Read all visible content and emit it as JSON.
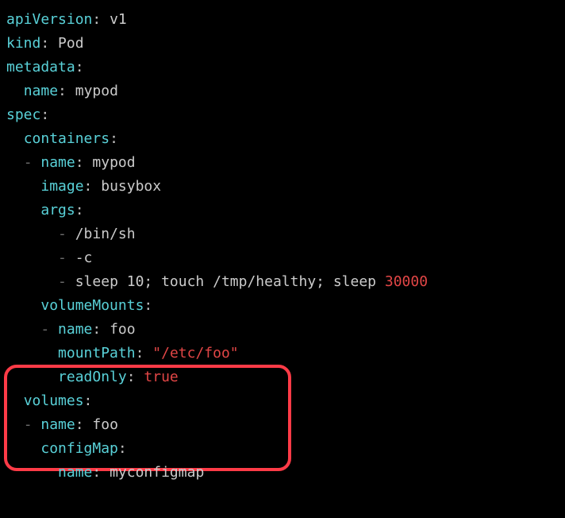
{
  "yaml": {
    "apiVersion": {
      "key": "apiVersion",
      "value": "v1"
    },
    "kind": {
      "key": "kind",
      "value": "Pod"
    },
    "metadata": {
      "key": "metadata",
      "name": {
        "key": "name",
        "value": "mypod"
      }
    },
    "spec": {
      "key": "spec",
      "containers": {
        "key": "containers",
        "item": {
          "name": {
            "key": "name",
            "value": "mypod"
          },
          "image": {
            "key": "image",
            "value": "busybox"
          },
          "args": {
            "key": "args",
            "values": [
              "/bin/sh",
              "-c",
              "sleep 10; touch /tmp/healthy; sleep "
            ],
            "tailNumber": "30000"
          },
          "volumeMounts": {
            "key": "volumeMounts",
            "item": {
              "name": {
                "key": "name",
                "value": "foo"
              },
              "mountPath": {
                "key": "mountPath",
                "value": "\"/etc/foo\""
              },
              "readOnly": {
                "key": "readOnly",
                "value": "true"
              }
            }
          }
        }
      },
      "volumes": {
        "key": "volumes",
        "item": {
          "name": {
            "key": "name",
            "value": "foo"
          },
          "configMap": {
            "key": "configMap",
            "name": {
              "key": "name",
              "value": "myconfigmap"
            }
          }
        }
      }
    }
  },
  "punct": {
    "colon": ":",
    "dash": "-"
  }
}
